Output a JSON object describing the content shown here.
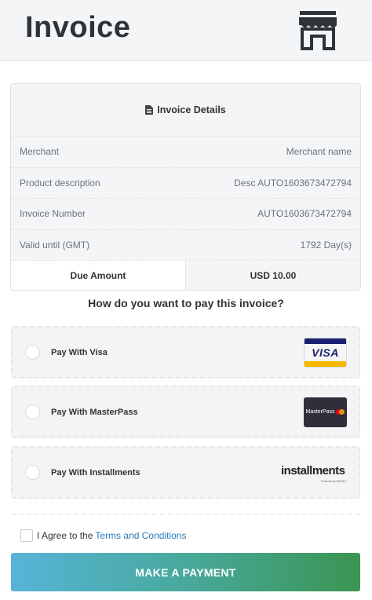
{
  "header": {
    "title": "Invoice",
    "icon": "store-icon"
  },
  "details": {
    "heading": "Invoice Details",
    "heading_icon": "document-icon",
    "rows": [
      {
        "label": "Merchant",
        "value": "Merchant name"
      },
      {
        "label": "Product description",
        "value": "Desc AUTO1603673472794"
      },
      {
        "label": "Invoice Number",
        "value": "AUTO1603673472794"
      },
      {
        "label": "Valid until (GMT)",
        "value": "1792 Day(s)"
      }
    ],
    "due_label": "Due Amount",
    "due_value": "USD 10.00"
  },
  "question": "How do you want to pay this invoice?",
  "payment_options": [
    {
      "label": "Pay With Visa",
      "logo_text": "VISA",
      "logo": "visa-logo"
    },
    {
      "label": "Pay With MasterPass",
      "logo_text": "MasterPass",
      "logo": "masterpass-logo"
    },
    {
      "label": "Pay With Installments",
      "logo_text": "installments",
      "logo_sub": "Powered by PAYSKY",
      "logo": "installments-logo"
    }
  ],
  "agree": {
    "prefix": "I Agree to the",
    "link": "Terms and Conditions",
    "checked": false
  },
  "pay_button": "MAKE A PAYMENT",
  "colors": {
    "header_bg": "#f4f5f7",
    "title": "#2e3338",
    "link": "#2a7ab8",
    "button_gradient_start": "#57b4d9",
    "button_gradient_end": "#3a9551"
  }
}
